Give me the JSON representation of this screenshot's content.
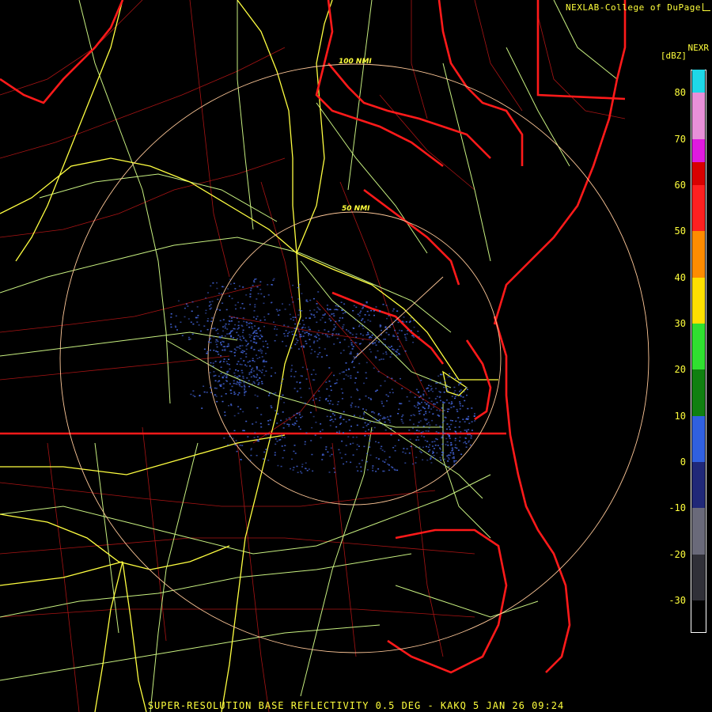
{
  "header": {
    "credit": "NEXLAB-College of DuPage",
    "product": "NEXR",
    "units": "[dBZ]"
  },
  "range_rings": {
    "inner_label": "50 NMI",
    "outer_label": "100 NMI"
  },
  "colorbar": {
    "ticks": [
      "80",
      "70",
      "60",
      "50",
      "40",
      "30",
      "20",
      "10",
      "0",
      "-10",
      "-20",
      "-30"
    ],
    "segments": [
      {
        "from": 80,
        "to": 85,
        "color": "#1ed8e8"
      },
      {
        "from": 70,
        "to": 80,
        "color": "#e890d8"
      },
      {
        "from": 65,
        "to": 70,
        "color": "#e01adf"
      },
      {
        "from": 60,
        "to": 65,
        "color": "#d80000"
      },
      {
        "from": 50,
        "to": 60,
        "color": "#ff2020"
      },
      {
        "from": 40,
        "to": 50,
        "color": "#ff8c00"
      },
      {
        "from": 30,
        "to": 40,
        "color": "#ffe000"
      },
      {
        "from": 20,
        "to": 30,
        "color": "#30e030"
      },
      {
        "from": 10,
        "to": 20,
        "color": "#108010"
      },
      {
        "from": 0,
        "to": 10,
        "color": "#3060e0"
      },
      {
        "from": -10,
        "to": 0,
        "color": "#202878"
      },
      {
        "from": -20,
        "to": -10,
        "color": "#6a6a7a"
      },
      {
        "from": -30,
        "to": -20,
        "color": "#303038"
      }
    ]
  },
  "footer": {
    "title": "SUPER-RESOLUTION BASE REFLECTIVITY 0.5 DEG - KAKQ 5 JAN 26 09:24"
  },
  "colors": {
    "state_border": "#ff1a1a",
    "county_border": "#b01010",
    "highway_primary": "#ffff40",
    "highway_secondary": "#c8f080",
    "range_ring": "#ffc898",
    "echo": "#4466dd"
  }
}
